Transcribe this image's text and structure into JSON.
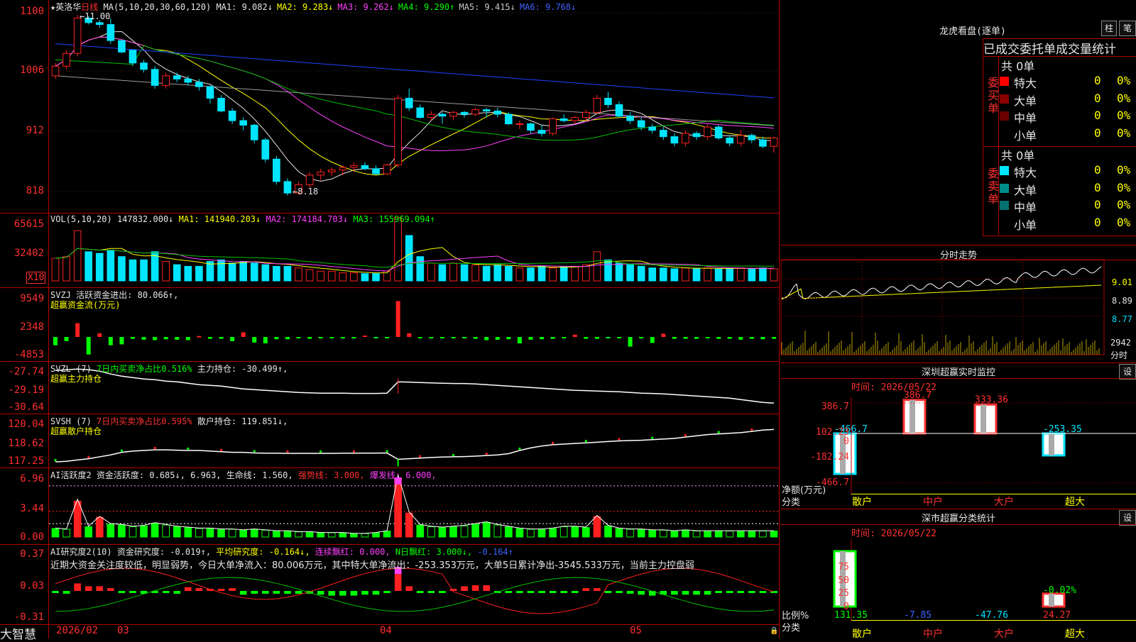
{
  "main_chart": {
    "stock_name": "英洛华",
    "period": "日线",
    "ma_label": "MA(5,10,20,30,60,120)",
    "ma_values": [
      {
        "name": "MA1:",
        "value": "9.082",
        "arrow": "↓",
        "color": "#e6e6e6"
      },
      {
        "name": "MA2:",
        "value": "9.283",
        "arrow": "↓",
        "color": "#ffff00"
      },
      {
        "name": "MA3:",
        "value": "9.262",
        "arrow": "↓",
        "color": "#ff40ff"
      },
      {
        "name": "MA4:",
        "value": "9.290",
        "arrow": "↑",
        "color": "#00ff00"
      },
      {
        "name": "MA5:",
        "value": "9.415",
        "arrow": "↓",
        "color": "#c8c8c8"
      },
      {
        "name": "MA6:",
        "value": "9.768",
        "arrow": "↓",
        "color": "#4060ff"
      }
    ],
    "y_labels": [
      "1100",
      "1006",
      "912",
      "818"
    ],
    "high_mark": "11.00",
    "low_mark": "8.18"
  },
  "vol_panel": {
    "label": "VOL(5,10,20)",
    "value": "147832.000↓",
    "ma1": "MA1: 141940.203↓",
    "ma2": "MA2: 174184.703↓",
    "ma3": "MA3: 155969.094↑",
    "y_labels": [
      "65615",
      "32402"
    ],
    "unit": "X10"
  },
  "svzj_panel": {
    "label": "SVZJ",
    "text1": "活跃资金进出: 80.066↑,",
    "text2": "超赢资金流(万元)",
    "y_labels": [
      "9549",
      "2348",
      "-4853"
    ]
  },
  "svzl_panel": {
    "label": "SVZL (7)",
    "text1": "7日内买卖净占比0.516%",
    "text2": "主力持仓: -30.499↑,",
    "text3": "超赢主力持仓",
    "y_labels": [
      "-27.74",
      "-29.19",
      "-30.64"
    ]
  },
  "svsh_panel": {
    "label": "SVSH (7)",
    "text1": "7日内买卖净占比0.595%",
    "text2": "散户持仓: 119.851↓,",
    "text3": "超赢散户持仓",
    "y_labels": [
      "120.04",
      "118.62",
      "117.25"
    ]
  },
  "ai2_panel": {
    "label": "AI活跃度2",
    "text1": "资金活跃度: 0.685↓, 6.963,",
    "text2": "生命线: 1.560,",
    "text3": "强势线: 3.000,",
    "text4": "爆发线: 6.000,",
    "y_labels": [
      "6.96",
      "3.44",
      "0.00"
    ]
  },
  "ai_research_panel": {
    "label": "AI研究度2(10)",
    "text1": "资金研究度: -0.019↑,",
    "text2": "平均研究度: -0.164↓,",
    "text3": "连续飘红: 0.000,",
    "text4": "N日飘红: 3.000↓,",
    "text5": "-0.164↑",
    "comment": "近期大资金关注度较低，明显弱势，今日大单净流入：80.006万元，其中特大单净流出：-253.353万元，大单5日累计净出-3545.533万元，当前主力控盘弱",
    "y_labels": [
      "0.37",
      "0.03",
      "-0.31"
    ]
  },
  "x_axis": {
    "labels": [
      "2026/02",
      "03",
      "04",
      "05"
    ]
  },
  "brand": "大智慧",
  "dragon_tiger": {
    "title": "龙虎看盘(逐单)",
    "btn1": "柱",
    "btn2": "笔",
    "heading": "已成交委托单成交量统计",
    "buy_label": "委买单",
    "sell_label": "委卖单",
    "buy_total": "共 0单",
    "sell_total": "共 0单",
    "buy_rows": [
      {
        "name": "特大",
        "count": "0",
        "pct": "0%",
        "color": "#ff0000"
      },
      {
        "name": "大单",
        "count": "0",
        "pct": "0%",
        "color": "#8b0000"
      },
      {
        "name": "中单",
        "count": "0",
        "pct": "0%",
        "color": "#6b0000"
      },
      {
        "name": "小单",
        "count": "0",
        "pct": "0%",
        "color": "#000000"
      }
    ],
    "sell_rows": [
      {
        "name": "特大",
        "count": "0",
        "pct": "0%",
        "color": "#00e5ff"
      },
      {
        "name": "大单",
        "count": "0",
        "pct": "0%",
        "color": "#008b8b"
      },
      {
        "name": "中单",
        "count": "0",
        "pct": "0%",
        "color": "#007070"
      },
      {
        "name": "小单",
        "count": "0",
        "pct": "0%",
        "color": "#000000"
      }
    ]
  },
  "intraday": {
    "title": "分时走势",
    "y_labels": [
      "9.01",
      "8.89",
      "8.77"
    ],
    "vol_labels": [
      "2942",
      "分时"
    ]
  },
  "sz_monitor": {
    "title": "深圳超赢实时监控",
    "btn": "设",
    "time": "时间: 2026/05/22",
    "y_labels": [
      "386.7",
      "102.23",
      "0",
      "-182.24",
      "-466.7"
    ],
    "net_label": "净额(万元)",
    "cat_label": "分类",
    "categories": [
      "散户",
      "中户",
      "大户",
      "超大"
    ]
  },
  "sz_class": {
    "title": "深市超赢分类统计",
    "btn": "设",
    "time": "时间: 2026/05/22",
    "y_labels": [
      "75",
      "50",
      "25",
      "0"
    ],
    "ratio_label": "比例%",
    "cat_label": "分类",
    "categories": [
      "散户",
      "中户",
      "大户",
      "超大"
    ],
    "value_colors": [
      "#00ff00",
      "#4060ff",
      "#00e5ff",
      "#ff3030"
    ]
  },
  "chart_data": [
    {
      "type": "candlestick",
      "title": "英洛华 日线",
      "ylim": [
        8.0,
        11.1
      ],
      "candles": [
        [
          10.05,
          10.25,
          10.0,
          10.2
        ],
        [
          10.2,
          10.45,
          10.15,
          10.4
        ],
        [
          10.4,
          11.0,
          10.35,
          10.95
        ],
        [
          10.95,
          10.98,
          10.85,
          10.88
        ],
        [
          10.88,
          10.92,
          10.8,
          10.85
        ],
        [
          10.85,
          10.95,
          10.55,
          10.6
        ],
        [
          10.6,
          10.45,
          10.4,
          10.42
        ],
        [
          10.45,
          10.45,
          10.2,
          10.25
        ],
        [
          10.25,
          10.3,
          10.1,
          10.15
        ],
        [
          10.15,
          10.2,
          9.85,
          9.9
        ],
        [
          9.9,
          10.1,
          9.85,
          10.05
        ],
        [
          10.05,
          10.1,
          9.95,
          10.0
        ],
        [
          10.0,
          10.05,
          9.9,
          9.95
        ],
        [
          9.95,
          10.0,
          9.82,
          9.88
        ],
        [
          9.88,
          9.9,
          9.62,
          9.7
        ],
        [
          9.7,
          9.75,
          9.48,
          9.5
        ],
        [
          9.5,
          9.55,
          9.3,
          9.35
        ],
        [
          9.35,
          9.4,
          9.2,
          9.28
        ],
        [
          9.28,
          9.3,
          9.0,
          9.05
        ],
        [
          9.05,
          9.08,
          8.7,
          8.75
        ],
        [
          8.75,
          8.8,
          8.35,
          8.4
        ],
        [
          8.4,
          8.45,
          8.18,
          8.22
        ],
        [
          8.22,
          8.4,
          8.2,
          8.35
        ],
        [
          8.35,
          8.55,
          8.3,
          8.5
        ],
        [
          8.5,
          8.6,
          8.42,
          8.55
        ],
        [
          8.55,
          8.62,
          8.48,
          8.58
        ],
        [
          8.58,
          8.65,
          8.5,
          8.62
        ],
        [
          8.62,
          8.7,
          8.55,
          8.65
        ],
        [
          8.65,
          8.7,
          8.58,
          8.6
        ],
        [
          8.6,
          8.65,
          8.5,
          8.52
        ],
        [
          8.52,
          8.68,
          8.5,
          8.66
        ],
        [
          8.66,
          9.75,
          8.62,
          9.7
        ],
        [
          9.7,
          9.85,
          9.5,
          9.55
        ],
        [
          9.55,
          9.6,
          9.38,
          9.4
        ],
        [
          9.4,
          9.5,
          9.35,
          9.45
        ],
        [
          9.45,
          9.48,
          9.3,
          9.42
        ],
        [
          9.42,
          9.5,
          9.36,
          9.48
        ],
        [
          9.48,
          9.5,
          9.4,
          9.45
        ],
        [
          9.45,
          9.55,
          9.42,
          9.52
        ],
        [
          9.52,
          9.55,
          9.4,
          9.5
        ],
        [
          9.5,
          9.55,
          9.4,
          9.45
        ],
        [
          9.45,
          9.48,
          9.28,
          9.3
        ],
        [
          9.3,
          9.35,
          9.22,
          9.3
        ],
        [
          9.3,
          9.32,
          9.15,
          9.2
        ],
        [
          9.2,
          9.28,
          9.1,
          9.15
        ],
        [
          9.15,
          9.4,
          9.12,
          9.38
        ],
        [
          9.38,
          9.45,
          9.32,
          9.35
        ],
        [
          9.35,
          9.42,
          9.3,
          9.4
        ],
        [
          9.4,
          9.52,
          9.35,
          9.48
        ],
        [
          9.48,
          9.75,
          9.45,
          9.7
        ],
        [
          9.7,
          9.8,
          9.55,
          9.6
        ],
        [
          9.6,
          9.65,
          9.4,
          9.42
        ],
        [
          9.42,
          9.48,
          9.3,
          9.35
        ],
        [
          9.35,
          9.4,
          9.2,
          9.25
        ],
        [
          9.25,
          9.3,
          9.15,
          9.2
        ],
        [
          9.2,
          9.25,
          9.05,
          9.1
        ],
        [
          9.1,
          9.15,
          8.95,
          9.0
        ],
        [
          9.0,
          9.2,
          8.95,
          9.15
        ],
        [
          9.15,
          9.18,
          9.05,
          9.1
        ],
        [
          9.1,
          9.3,
          9.05,
          9.25
        ],
        [
          9.25,
          9.28,
          9.05,
          9.08
        ],
        [
          9.08,
          9.12,
          8.95,
          9.0
        ],
        [
          9.0,
          9.2,
          8.95,
          9.12
        ],
        [
          9.12,
          9.15,
          9.0,
          9.05
        ],
        [
          9.05,
          9.1,
          8.92,
          8.95
        ],
        [
          8.95,
          9.1,
          8.85,
          9.08
        ]
      ]
    },
    {
      "type": "bar",
      "title": "VOL",
      "ylim": [
        0,
        70000
      ],
      "values": [
        28000,
        30000,
        62000,
        36000,
        34000,
        38000,
        30000,
        26000,
        26000,
        36000,
        24000,
        20000,
        18000,
        18000,
        24000,
        26000,
        22000,
        24000,
        22000,
        20000,
        18000,
        18000,
        16000,
        14000,
        12000,
        12000,
        10000,
        10000,
        9000,
        9000,
        12000,
        78000,
        56000,
        30000,
        22000,
        20000,
        22000,
        20000,
        20000,
        18000,
        20000,
        18000,
        16000,
        16000,
        18000,
        16000,
        18000,
        18000,
        20000,
        36000,
        26000,
        22000,
        20000,
        18000,
        16000,
        16000,
        15000,
        16000,
        15000,
        16000,
        15000,
        15000,
        16000,
        15000,
        16000,
        15000
      ]
    },
    {
      "type": "bar",
      "title": "超赢资金流(万元)",
      "ylim": [
        -4853,
        9549
      ],
      "values": [
        -1800,
        -900,
        3000,
        -3800,
        800,
        -1800,
        -1600,
        -400,
        -600,
        -700,
        -500,
        -600,
        -700,
        200,
        -400,
        -400,
        -900,
        1000,
        -1200,
        -1400,
        -500,
        -500,
        -200,
        -400,
        -300,
        -300,
        -300,
        -300,
        300,
        -300,
        -200,
        7800,
        800,
        -200,
        -200,
        -200,
        -300,
        -200,
        -400,
        -700,
        -600,
        -500,
        -1400,
        -600,
        -500,
        -400,
        -300,
        500,
        -400,
        -400,
        -300,
        -300,
        -2100,
        -300,
        -1300,
        700,
        -400,
        -400,
        -400,
        -300,
        -400,
        -400,
        -600,
        -400,
        -500,
        -400
      ]
    },
    {
      "type": "line",
      "title": "超赢主力持仓",
      "ylim": [
        -30.64,
        -27.74
      ],
      "values": [
        -28.0,
        -27.95,
        -27.9,
        -27.95,
        -28.05,
        -28.25,
        -28.4,
        -28.5,
        -28.6,
        -28.65,
        -28.75,
        -28.8,
        -28.9,
        -29.0,
        -29.05,
        -29.1,
        -29.2,
        -29.3,
        -29.35,
        -29.4,
        -29.45,
        -29.5,
        -29.55,
        -29.58,
        -29.6,
        -29.6,
        -29.6,
        -29.62,
        -29.62,
        -29.62,
        -29.6,
        -28.8,
        -28.82,
        -28.85,
        -28.88,
        -28.9,
        -28.92,
        -28.92,
        -28.95,
        -29.0,
        -29.05,
        -29.1,
        -29.15,
        -29.2,
        -29.25,
        -29.3,
        -29.35,
        -29.4,
        -29.42,
        -29.45,
        -29.48,
        -29.5,
        -29.55,
        -29.6,
        -29.62,
        -29.65,
        -29.7,
        -29.75,
        -29.8,
        -29.85,
        -29.9,
        -29.95,
        -30.05,
        -30.15,
        -30.25,
        -30.3
      ]
    },
    {
      "type": "line",
      "title": "超赢散户持仓",
      "ylim": [
        117.25,
        120.04
      ],
      "values": [
        117.3,
        117.35,
        117.45,
        117.55,
        117.7,
        117.85,
        118.05,
        118.15,
        118.2,
        118.25,
        118.25,
        118.22,
        118.2,
        118.2,
        118.15,
        118.1,
        118.05,
        118.05,
        118.0,
        117.98,
        117.98,
        117.97,
        117.97,
        117.97,
        117.97,
        117.97,
        117.98,
        117.98,
        117.99,
        117.99,
        118.0,
        117.5,
        117.55,
        117.6,
        117.65,
        117.68,
        117.7,
        117.72,
        117.75,
        117.8,
        117.85,
        117.95,
        118.2,
        118.4,
        118.55,
        118.65,
        118.7,
        118.75,
        118.8,
        118.85,
        118.9,
        118.95,
        118.98,
        119.0,
        119.05,
        119.1,
        119.15,
        119.25,
        119.35,
        119.45,
        119.5,
        119.55,
        119.6,
        119.7,
        119.8,
        119.85
      ]
    },
    {
      "type": "bar",
      "title": "AI活跃度2",
      "ylim": [
        0,
        6.96
      ],
      "values": [
        1.0,
        0.9,
        4.2,
        1.2,
        2.3,
        1.5,
        1.4,
        1.2,
        1.3,
        1.6,
        1.4,
        1.2,
        1.1,
        1.0,
        1.0,
        0.9,
        0.9,
        0.8,
        0.9,
        0.8,
        0.7,
        0.7,
        0.6,
        0.6,
        0.5,
        0.5,
        0.5,
        0.4,
        0.4,
        0.5,
        0.7,
        6.9,
        2.8,
        1.4,
        1.2,
        1.1,
        1.2,
        1.3,
        1.5,
        1.7,
        1.4,
        1.2,
        1.0,
        0.9,
        0.9,
        1.0,
        1.2,
        1.2,
        1.1,
        2.4,
        1.3,
        1.0,
        0.9,
        0.9,
        0.8,
        0.8,
        0.7,
        0.8,
        0.7,
        0.7,
        0.7,
        0.7,
        0.7,
        0.7,
        0.7,
        0.7
      ]
    },
    {
      "type": "bar",
      "title": "AI研究度2(10)",
      "ylim": [
        -0.31,
        0.37
      ],
      "values": [
        -0.02,
        -0.03,
        0.08,
        0.05,
        0.05,
        0.03,
        -0.02,
        -0.02,
        -0.03,
        -0.02,
        -0.02,
        -0.03,
        0.04,
        0.03,
        0.02,
        0.02,
        0.03,
        -0.04,
        -0.03,
        -0.03,
        -0.03,
        -0.03,
        -0.03,
        -0.03,
        -0.04,
        -0.05,
        -0.05,
        -0.05,
        -0.04,
        -0.04,
        -0.02,
        0.18,
        0.05,
        -0.02,
        -0.01,
        -0.01,
        0.02,
        0.05,
        0.06,
        0.06,
        -0.02,
        -0.02,
        -0.02,
        -0.02,
        -0.02,
        -0.02,
        -0.02,
        -0.02,
        0.03,
        0.03,
        -0.02,
        -0.02,
        -0.03,
        -0.04,
        -0.05,
        -0.04,
        -0.04,
        -0.04,
        -0.04,
        -0.04,
        -0.02,
        -0.02,
        -0.02,
        -0.02,
        -0.02,
        -0.02
      ]
    },
    {
      "type": "bar",
      "title": "深圳超赢实时监控",
      "categories": [
        "散户",
        "中户",
        "大户",
        "超大"
      ],
      "values": [
        -466.7,
        386.7,
        333.36,
        -253.35
      ],
      "ylim": [
        -466.7,
        386.7
      ]
    },
    {
      "type": "bar",
      "title": "深市超赢分类统计",
      "categories": [
        "散户",
        "中户",
        "大户",
        "超大"
      ],
      "values": [
        131.35,
        -7.85,
        -47.76,
        24.27
      ],
      "ylim": [
        0,
        75
      ]
    }
  ]
}
